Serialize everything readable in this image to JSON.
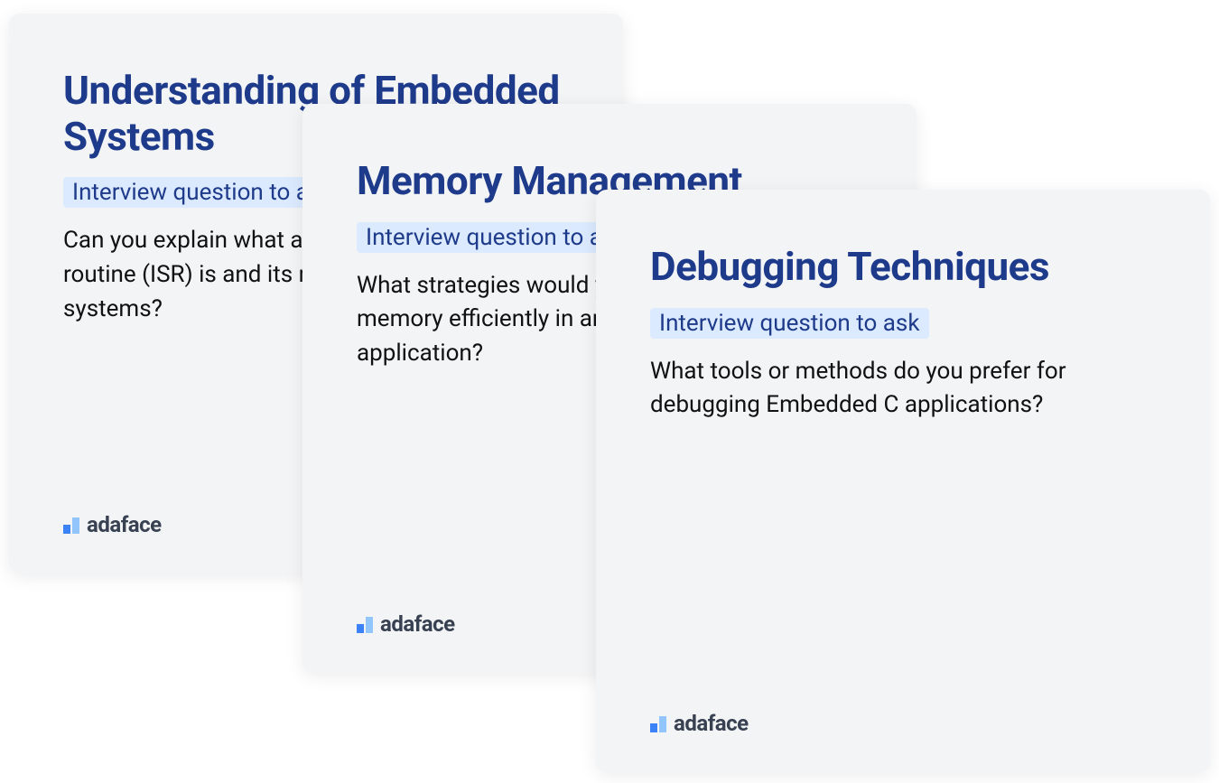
{
  "cards": [
    {
      "title": "Understanding of Embedded Systems",
      "badge": "Interview question to ask",
      "body": "Can you explain what an interrupt service routine (ISR) is and its role in embedded systems?"
    },
    {
      "title": "Memory Management",
      "badge": "Interview question to ask",
      "body": "What strategies would you use to manage memory efficiently in an embedded C application?"
    },
    {
      "title": "Debugging Techniques",
      "badge": "Interview question to ask",
      "body": "What tools or methods do you prefer for debugging Embedded C applications?"
    }
  ],
  "brand": "adaface"
}
